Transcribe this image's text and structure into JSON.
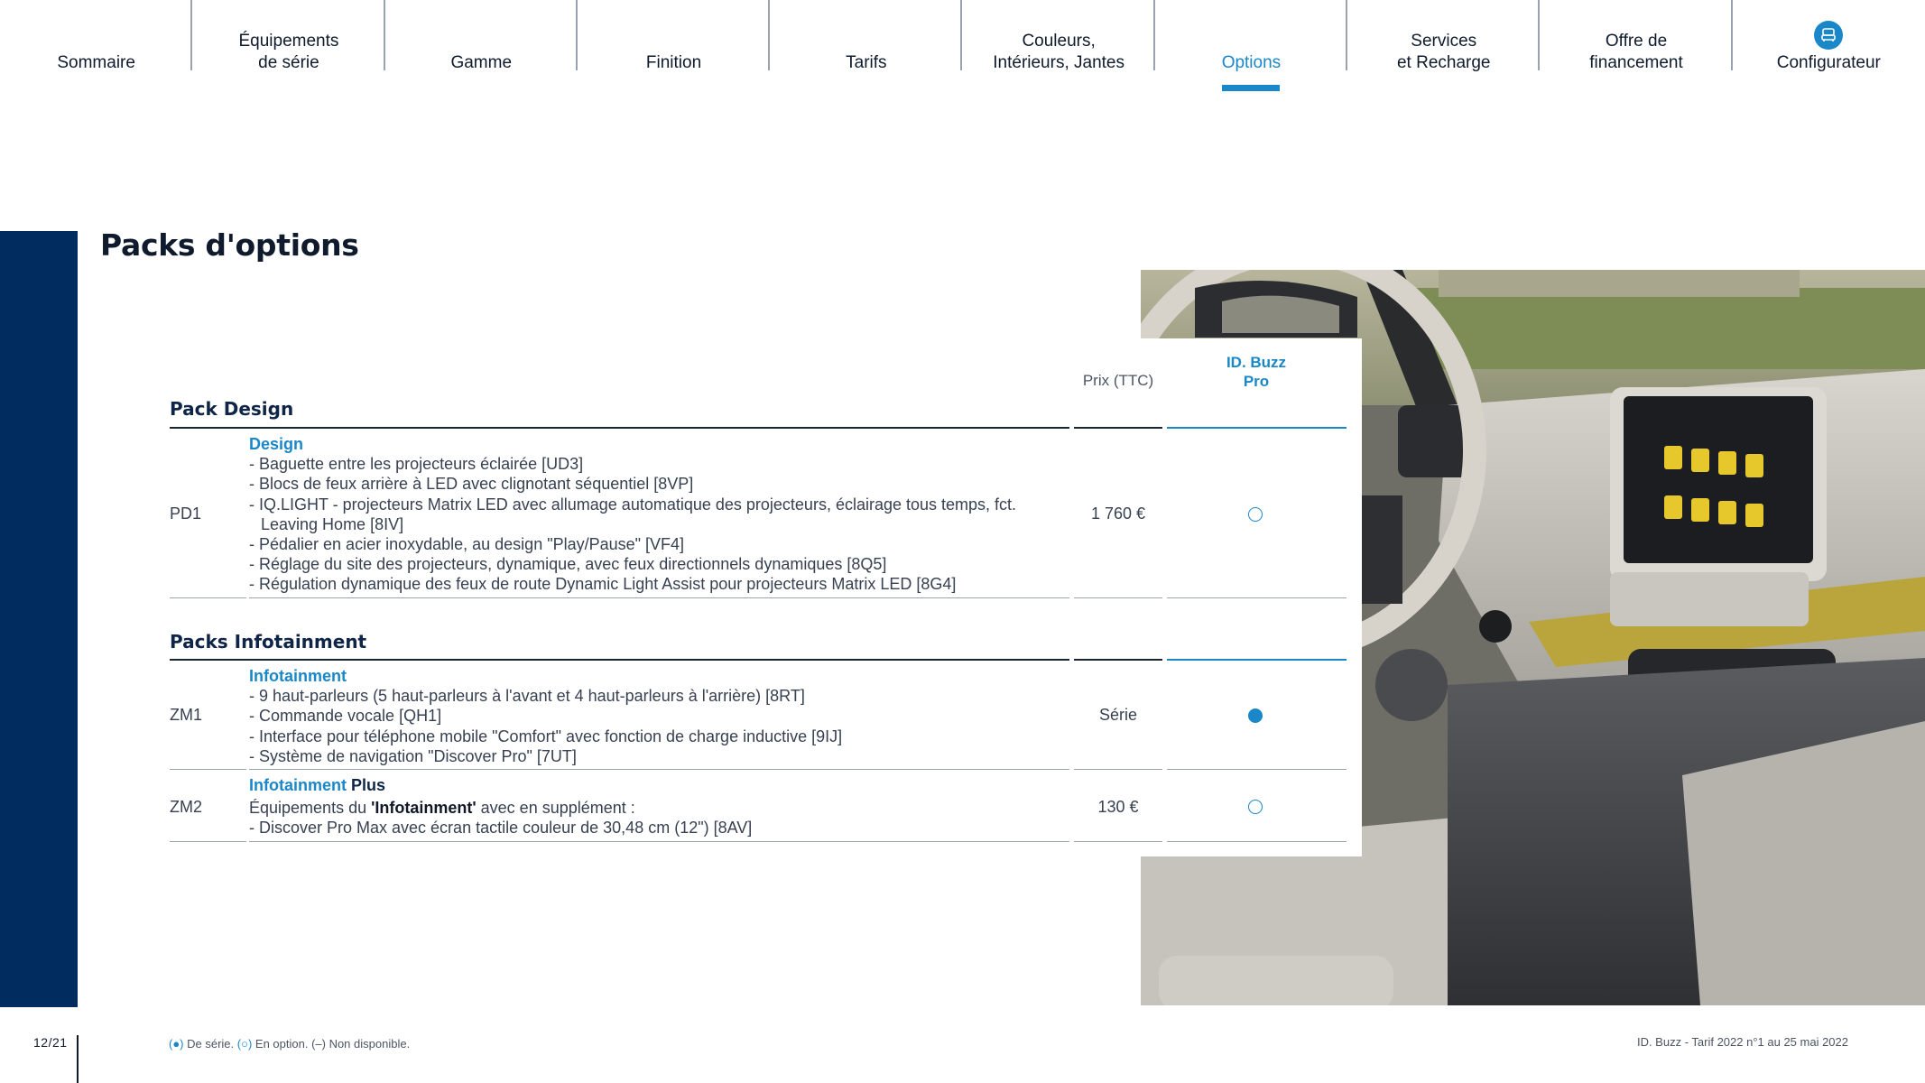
{
  "nav": {
    "items": [
      {
        "label": "Sommaire"
      },
      {
        "label": "Équipements\nde série"
      },
      {
        "label": "Gamme"
      },
      {
        "label": "Finition"
      },
      {
        "label": "Tarifs"
      },
      {
        "label": "Couleurs,\nIntérieurs, Jantes"
      },
      {
        "label": "Options"
      },
      {
        "label": "Services\net Recharge"
      },
      {
        "label": "Offre de\nfinancement"
      },
      {
        "label": "Configurateur"
      }
    ],
    "active": "Options"
  },
  "page": {
    "title": "Packs d'options"
  },
  "table": {
    "headers": {
      "price": "Prix (TTC)",
      "model_line1": "ID. Buzz",
      "model_line2": "Pro"
    },
    "sections": [
      {
        "title": "Pack Design",
        "rows": [
          {
            "code": "PD1",
            "heading": "Design",
            "lines": [
              "- Baguette entre les projecteurs éclairée [UD3]",
              "- Blocs de feux arrière à LED avec clignotant séquentiel [8VP]",
              "- IQ.LIGHT - projecteurs Matrix LED avec allumage automatique des projecteurs, éclairage tous temps, fct.",
              "Leaving Home [8IV]",
              "- Pédalier en acier inoxydable, au design \"Play/Pause\" [VF4]",
              "- Réglage du site des projecteurs, dynamique, avec feux directionnels dynamiques [8Q5]",
              "- Régulation dynamique des feux de route Dynamic Light Assist pour projecteurs Matrix LED [8G4]"
            ],
            "price": "1 760 €",
            "availability": "option"
          }
        ]
      },
      {
        "title": "Packs Infotainment",
        "rows": [
          {
            "code": "ZM1",
            "heading": "Infotainment",
            "lines": [
              "- 9 haut-parleurs (5 haut-parleurs à l'avant et 4 haut-parleurs à l'arrière) [8RT]",
              "- Commande vocale [QH1]",
              "- Interface pour téléphone mobile \"Comfort\" avec fonction de charge inductive [9IJ]",
              "- Système de navigation \"Discover Pro\" [7UT]"
            ],
            "price": "Série",
            "availability": "standard"
          },
          {
            "code": "ZM2",
            "heading": "Infotainment",
            "heading_suffix": " Plus",
            "line1_prefix": "Équipements du ",
            "line1_bold": "'Infotainment'",
            "line1_suffix": " avec en supplément :",
            "lines": [
              "- Discover Pro Max avec écran tactile couleur de 30,48 cm (12\") [8AV]"
            ],
            "price": "130 €",
            "availability": "option"
          }
        ]
      }
    ]
  },
  "footer": {
    "page_number": "12/21",
    "legend_std_mark": "(●)",
    "legend_std": " De série. ",
    "legend_opt_mark": "(○)",
    "legend_opt": " En option. ",
    "legend_na_mark": "(–)",
    "legend_na": " Non disponible.",
    "document": "ID. Buzz - Tarif 2022 n°1 au 25 mai 2022"
  },
  "colors": {
    "accent": "#1a87c8",
    "navy": "#002c5f"
  },
  "icons": {
    "configurator": "car-seat-icon"
  }
}
